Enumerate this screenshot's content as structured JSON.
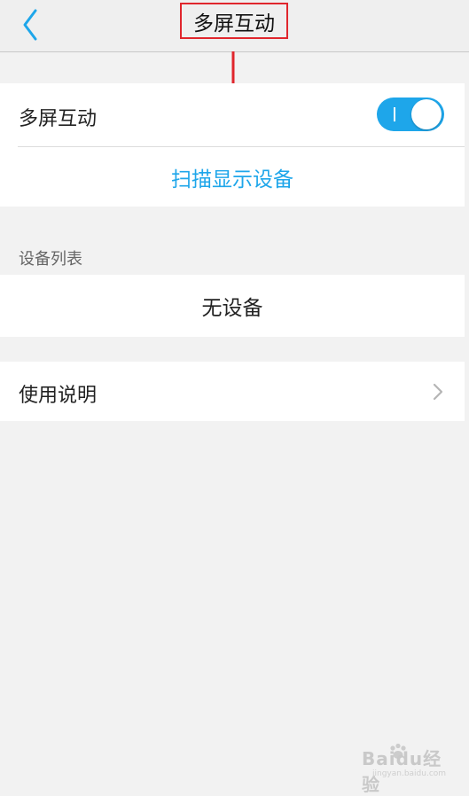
{
  "navbar": {
    "title": "多屏互动",
    "back_icon": "chevron-left-icon"
  },
  "screen_share": {
    "label": "多屏互动",
    "toggle_on": true,
    "scan_label": "扫描显示设备"
  },
  "device_list": {
    "header": "设备列表",
    "empty_text": "无设备"
  },
  "help": {
    "label": "使用说明",
    "icon": "chevron-right-icon"
  },
  "watermark": {
    "main": "Baidu经验",
    "sub": "jingyan.baidu.com"
  },
  "colors": {
    "accent": "#1ea6ea",
    "annotation_red": "#e0262d",
    "background": "#f2f2f2"
  }
}
